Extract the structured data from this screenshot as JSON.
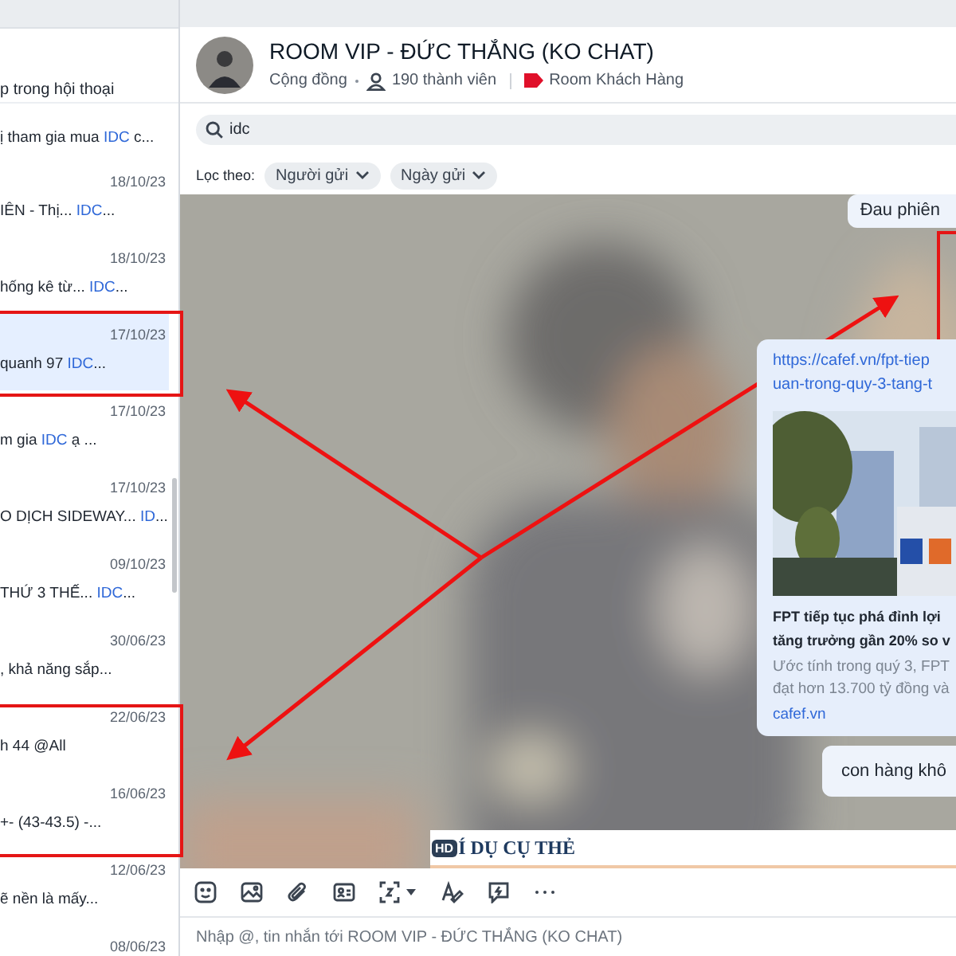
{
  "sidebar": {
    "header": "p trong hội thoại",
    "results": [
      {
        "text": "ị tham gia mua ",
        "match": "IDC",
        "rest": " c...",
        "selected": false
      },
      {
        "date": "18/10/23",
        "text": "IÊN - Thị... ",
        "match": "IDC",
        "rest": "...",
        "selected": false
      },
      {
        "date": "18/10/23",
        "text": "hống kê từ... ",
        "match": "IDC",
        "rest": "...",
        "selected": false
      },
      {
        "date": "17/10/23",
        "text": " quanh 97 ",
        "match": "IDC",
        "rest": "...",
        "selected": true
      },
      {
        "date": "17/10/23",
        "text": "m gia ",
        "match": "IDC",
        "rest": " ạ ...",
        "selected": false
      },
      {
        "date": "17/10/23",
        "text": "O DỊCH SIDEWAY... ",
        "match": "ID",
        "rest": "...",
        "selected": false
      },
      {
        "date": "09/10/23",
        "text": " THỨ 3 THẾ... ",
        "match": "IDC",
        "rest": "...",
        "selected": false
      },
      {
        "date": "30/06/23",
        "text": ", khả năng sắp...",
        "selected": false
      },
      {
        "date": "22/06/23",
        "text": "h 44 @All",
        "selected": false
      },
      {
        "date": "16/06/23",
        "text": "+- (43-43.5) -...",
        "selected": false
      },
      {
        "date": "12/06/23",
        "text": "ẽ nền là mấy...",
        "selected": false
      },
      {
        "date": "08/06/23",
        "selected": false
      }
    ]
  },
  "chat": {
    "title": "ROOM VIP - ĐỨC THẮNG (KO CHAT)",
    "kind_label": "Cộng đồng",
    "members": "190 thành viên",
    "tag": "Room Khách Hàng",
    "search": {
      "value": "idc"
    },
    "filter_label": "Lọc theo:",
    "filters": [
      "Người gửi",
      "Ngày gửi"
    ],
    "messages": [
      {
        "kind": "text",
        "text": "Đau phiên"
      },
      {
        "kind": "link",
        "url": [
          "https://cafef.vn/fpt-tiep",
          "uan-trong-quy-3-tang-t"
        ],
        "title": [
          "FPT tiếp tục phá đỉnh lợi",
          "tăng trưởng gần 20% so v"
        ],
        "description": [
          "Ước tính trong quý 3, FPT",
          "đạt hơn 13.700 tỷ đồng và"
        ],
        "source": "cafef.vn"
      },
      {
        "kind": "text",
        "text": "con hàng khô"
      }
    ],
    "pinned": {
      "badge": "HD",
      "text": "Í DỤ CỤ THẺ"
    },
    "input": {
      "placeholder": "Nhập @, tin nhắn tới ROOM VIP - ĐỨC THẮNG (KO CHAT)"
    }
  }
}
